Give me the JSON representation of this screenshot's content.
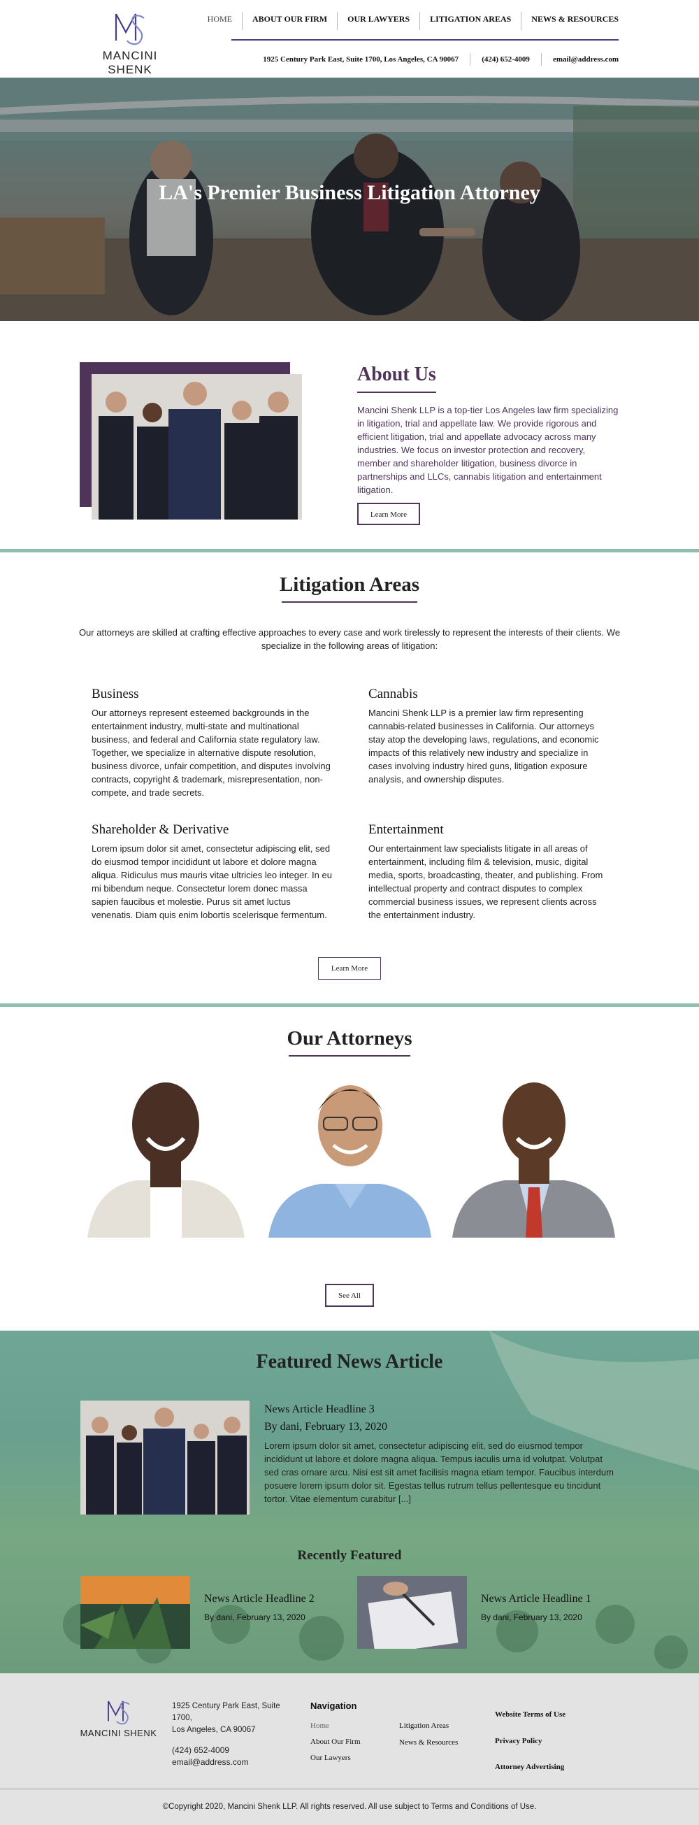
{
  "brand": {
    "name": "MANCINI SHENK",
    "accent": "#4e3459",
    "nav_accent": "#4b3a8e",
    "divider_color": "#8fbfae"
  },
  "nav": {
    "items": [
      "HOME",
      "ABOUT OUR FIRM",
      "OUR LAWYERS",
      "LITIGATION AREAS",
      "NEWS & RESOURCES"
    ],
    "active": "HOME"
  },
  "contact": {
    "address": "1925 Century Park East, Suite 1700, Los Angeles, CA 90067",
    "phone": "(424) 652-4009",
    "email": "email@address.com"
  },
  "hero": {
    "title": "LA's Premier Business Litigation Attorney"
  },
  "about": {
    "title": "About Us",
    "text": "Mancini Shenk LLP is a top-tier Los Angeles law firm specializing in litigation, trial and appellate law. We provide rigorous and efficient litigation, trial and appellate advocacy across many industries. We focus on investor protection and recovery, member and shareholder litigation, business divorce in partnerships and LLCs, cannabis litigation and entertainment litigation.",
    "button": "Learn More"
  },
  "litigation": {
    "title": "Litigation Areas",
    "intro": "Our attorneys are skilled at crafting effective approaches to every case and work tirelessly to represent the interests of their clients. We specialize in the following areas of litigation:",
    "areas": [
      {
        "title": "Business",
        "text": "Our attorneys represent esteemed backgrounds in the entertainment industry, multi-state and multinational business, and federal and California state regulatory law. Together, we specialize in alternative dispute resolution, business divorce, unfair competition, and disputes involving contracts, copyright & trademark, misrepresentation, non-compete, and trade secrets."
      },
      {
        "title": "Cannabis",
        "text": "Mancini Shenk LLP is a premier law firm representing cannabis-related businesses in California. Our attorneys stay atop the developing laws, regulations, and economic impacts of this relatively new industry and specialize in cases involving industry hired guns, litigation exposure analysis, and ownership disputes."
      },
      {
        "title": "Shareholder & Derivative",
        "text": "Lorem ipsum dolor sit amet, consectetur adipiscing elit, sed do eiusmod tempor incididunt ut labore et dolore magna aliqua. Ridiculus mus mauris vitae ultricies leo integer. In eu mi bibendum neque. Consectetur lorem donec massa sapien faucibus et molestie. Purus sit amet luctus venenatis. Diam quis enim lobortis scelerisque fermentum."
      },
      {
        "title": "Entertainment",
        "text": "Our entertainment law specialists litigate in all areas of entertainment, including film & television, music, digital media, sports, broadcasting, theater, and publishing. From intellectual property and contract disputes to complex commercial business issues, we represent clients across the entertainment industry."
      }
    ],
    "button": "Learn More"
  },
  "attorneys": {
    "title": "Our Attorneys",
    "button": "See All"
  },
  "featured": {
    "title": "Featured News Article",
    "article": {
      "headline": "News Article Headline 3",
      "byline": "By dani, February 13, 2020",
      "text": "Lorem ipsum dolor sit amet, consectetur adipiscing elit, sed do eiusmod tempor incididunt ut labore et dolore magna aliqua. Tempus iaculis urna id volutpat. Volutpat sed cras ornare arcu. Nisi est sit amet facilisis magna etiam tempor. Faucibus interdum posuere lorem ipsum dolor sit. Egestas tellus rutrum tellus pellentesque eu tincidunt tortor. Vitae elementum curabitur [...]"
    },
    "recent_title": "Recently Featured",
    "recent": [
      {
        "headline": "News Article Headline 2",
        "byline": "By dani, February 13, 2020"
      },
      {
        "headline": "News Article Headline 1",
        "byline": "By dani, February 13, 2020"
      }
    ]
  },
  "footer": {
    "address_line1": "1925 Century Park East, Suite 1700,",
    "address_line2": "Los Angeles, CA 90067",
    "phone": "(424) 652-4009",
    "email": "email@address.com",
    "nav_title": "Navigation",
    "nav_col1": [
      "Home",
      "About Our Firm",
      "Our Lawyers"
    ],
    "nav_col2": [
      "Litigation Areas",
      "News & Resources"
    ],
    "legal": [
      "Website Terms of Use",
      "Privacy Policy",
      "Attorney Advertising"
    ],
    "copyright": "©Copyright 2020, Mancini Shenk LLP. All rights reserved. All use subject to Terms and Conditions of Use."
  }
}
